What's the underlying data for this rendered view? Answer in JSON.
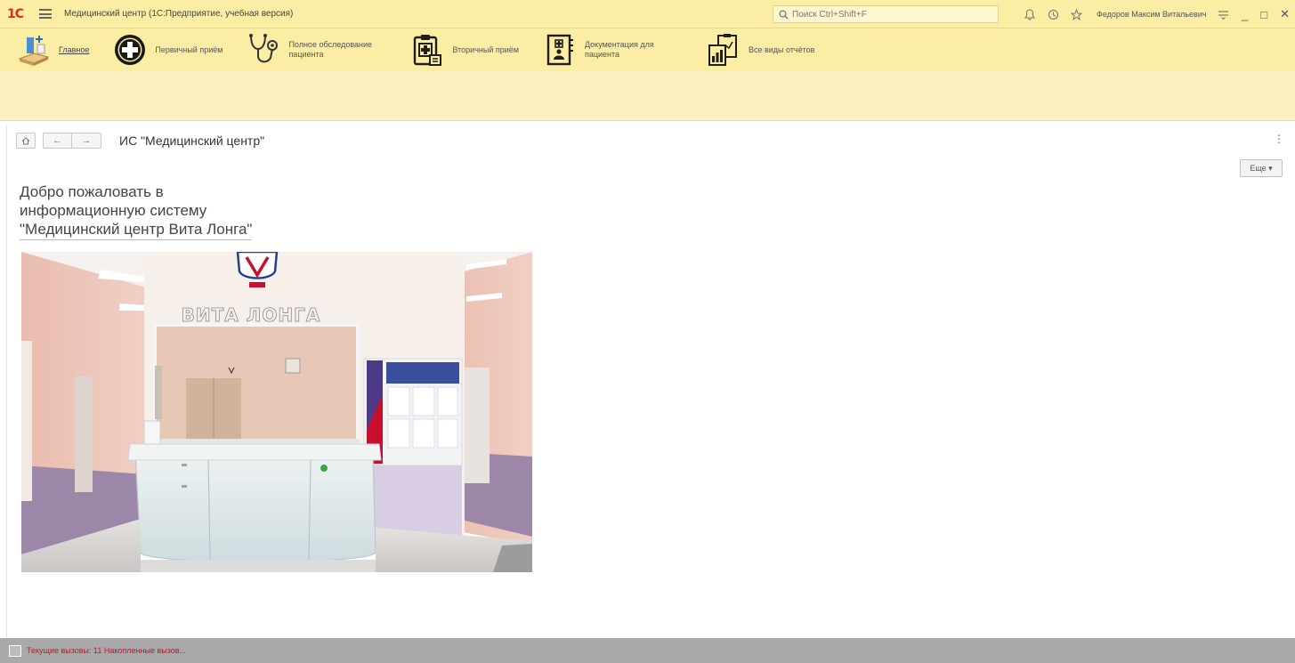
{
  "titlebar": {
    "logo": "1С",
    "app_title": "Медицинский центр  (1С:Предприятие, учебная версия)",
    "search_placeholder": "Поиск Ctrl+Shift+F",
    "user_name": "Федоров Максим Витальевич"
  },
  "sections": [
    {
      "label": "Главное",
      "icon": "home-desk-icon",
      "active": true
    },
    {
      "label": "Первичный приём",
      "icon": "plus-circle-icon"
    },
    {
      "label": "Полное обследование пациента",
      "icon": "stethoscope-icon"
    },
    {
      "label": "Вторичный приём",
      "icon": "clipboard-medical-icon"
    },
    {
      "label": "Документация для пациента",
      "icon": "document-patient-icon"
    },
    {
      "label": "Все виды отчётов",
      "icon": "reports-icon"
    }
  ],
  "content": {
    "page_title": "ИС \"Медицинский центр\"",
    "more_button": "Еще ▾",
    "welcome": {
      "line1": "Добро пожаловать в",
      "line2": "информационную систему",
      "line3": "\"Медицинский центр Вита Лонга\""
    },
    "photo": {
      "sign_text": "ВИТА  ЛОНГА"
    }
  },
  "statusbar": {
    "text": "Текущие вызовы: 11   Накопленные вызов..."
  },
  "colors": {
    "toolbar_bg": "#fbeda4",
    "strip_bg": "#fcf2c1",
    "statusbar_bg": "#a9a9a9",
    "status_text": "#c8102e",
    "logo_red": "#d4301a"
  }
}
